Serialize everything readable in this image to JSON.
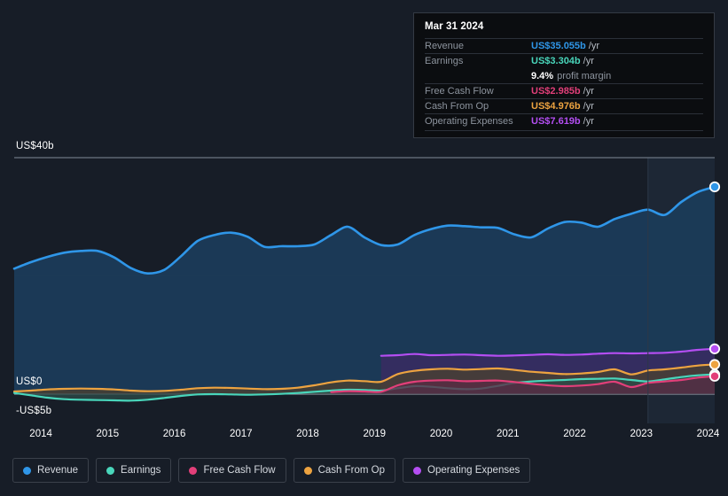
{
  "tooltip": {
    "date": "Mar 31 2024",
    "rows": [
      {
        "name": "Revenue",
        "value": "US$35.055b",
        "unit": "/yr",
        "color": "#2f96e8"
      },
      {
        "name": "Earnings",
        "value": "US$3.304b",
        "unit": "/yr",
        "color": "#49d6bb"
      },
      {
        "name": "Free Cash Flow",
        "value": "US$2.985b",
        "unit": "/yr",
        "color": "#e23f79"
      },
      {
        "name": "Cash From Op",
        "value": "US$4.976b",
        "unit": "/yr",
        "color": "#eda340"
      },
      {
        "name": "Operating Expenses",
        "value": "US$7.619b",
        "unit": "/yr",
        "color": "#b44ef2"
      }
    ],
    "profit_margin_value": "9.4%",
    "profit_margin_label": "profit margin"
  },
  "legend": [
    {
      "label": "Revenue",
      "color": "#2f96e8"
    },
    {
      "label": "Earnings",
      "color": "#49d6bb"
    },
    {
      "label": "Free Cash Flow",
      "color": "#e23f79"
    },
    {
      "label": "Cash From Op",
      "color": "#eda340"
    },
    {
      "label": "Operating Expenses",
      "color": "#b44ef2"
    }
  ],
  "axis": {
    "y_labels": {
      "top": "US$40b",
      "zero": "US$0",
      "bottom": "-US$5b"
    },
    "x_labels": [
      "2014",
      "2015",
      "2016",
      "2017",
      "2018",
      "2019",
      "2020",
      "2021",
      "2022",
      "2023",
      "2024"
    ]
  },
  "chart_data": {
    "type": "area",
    "title": "",
    "xlabel": "",
    "ylabel": "US$",
    "ylim": [
      -5,
      40
    ],
    "grid": true,
    "legend_position": "bottom",
    "gridlines": [
      40,
      20,
      0
    ],
    "x_tick_labels": [
      "2014",
      "2015",
      "2016",
      "2017",
      "2018",
      "2019",
      "2020",
      "2021",
      "2022",
      "2023",
      "2024"
    ],
    "x_tick_positions": [
      2014,
      2015,
      2016,
      2017,
      2018,
      2019,
      2020,
      2021,
      2022,
      2023,
      2024
    ],
    "forecast_start": 2023.1,
    "units": "US$ billions per year",
    "x": [
      2013.6,
      2013.85,
      2014.1,
      2014.35,
      2014.6,
      2014.85,
      2015.1,
      2015.35,
      2015.6,
      2015.85,
      2016.1,
      2016.35,
      2016.6,
      2016.85,
      2017.1,
      2017.35,
      2017.6,
      2017.85,
      2018.1,
      2018.35,
      2018.6,
      2018.85,
      2019.1,
      2019.35,
      2019.6,
      2019.85,
      2020.1,
      2020.35,
      2020.6,
      2020.85,
      2021.1,
      2021.35,
      2021.6,
      2021.85,
      2022.1,
      2022.35,
      2022.6,
      2022.85,
      2023.1,
      2023.35,
      2023.6,
      2023.85,
      2024.1
    ],
    "series": [
      {
        "name": "Revenue",
        "color": "#2f96e8",
        "fill": "#1b3b58",
        "end_value": 35.055,
        "end_marker": true,
        "values": [
          21.2,
          22.3,
          23.2,
          23.9,
          24.2,
          24.2,
          23.1,
          21.3,
          20.4,
          21.0,
          23.3,
          25.9,
          26.9,
          27.3,
          26.6,
          24.9,
          25.0,
          25.0,
          25.3,
          26.9,
          28.3,
          26.5,
          25.2,
          25.3,
          26.9,
          27.9,
          28.5,
          28.4,
          28.2,
          28.1,
          27.0,
          26.5,
          28.0,
          29.1,
          29.0,
          28.3,
          29.6,
          30.5,
          31.2,
          30.3,
          32.5,
          34.2,
          35.055
        ]
      },
      {
        "name": "Operating Expenses",
        "color": "#b44ef2",
        "fill": "#3b2a63",
        "start_x": 2019.05,
        "end_value": 7.619,
        "end_marker": true,
        "values": [
          null,
          null,
          null,
          null,
          null,
          null,
          null,
          null,
          null,
          null,
          null,
          null,
          null,
          null,
          null,
          null,
          null,
          null,
          null,
          null,
          null,
          null,
          6.45,
          6.55,
          6.75,
          6.55,
          6.6,
          6.65,
          6.55,
          6.45,
          6.5,
          6.6,
          6.7,
          6.6,
          6.65,
          6.8,
          6.9,
          6.85,
          6.9,
          6.95,
          7.15,
          7.45,
          7.619
        ]
      },
      {
        "name": "Cash From Op",
        "color": "#eda340",
        "fill": "#4a4030",
        "end_value": 4.976,
        "end_marker": true,
        "values": [
          0.4,
          0.55,
          0.75,
          0.85,
          0.9,
          0.85,
          0.75,
          0.55,
          0.45,
          0.5,
          0.7,
          0.95,
          1.05,
          1.0,
          0.9,
          0.8,
          0.85,
          1.05,
          1.45,
          1.95,
          2.25,
          2.15,
          2.05,
          3.35,
          3.9,
          4.15,
          4.25,
          4.1,
          4.2,
          4.3,
          4.05,
          3.75,
          3.55,
          3.35,
          3.45,
          3.7,
          4.15,
          3.3,
          3.95,
          4.15,
          4.45,
          4.8,
          4.976
        ]
      },
      {
        "name": "Earnings",
        "color": "#49d6bb",
        "fill": "#2c4a48",
        "end_value": 3.304,
        "end_marker": true,
        "values": [
          0.15,
          -0.25,
          -0.65,
          -0.9,
          -1.0,
          -1.05,
          -1.1,
          -1.15,
          -1.0,
          -0.7,
          -0.35,
          -0.1,
          -0.05,
          -0.1,
          -0.15,
          -0.1,
          0.0,
          0.15,
          0.35,
          0.55,
          0.7,
          0.65,
          0.55,
          0.95,
          1.3,
          1.2,
          0.95,
          0.8,
          0.9,
          1.35,
          1.85,
          2.1,
          2.25,
          2.35,
          2.5,
          2.55,
          2.6,
          2.35,
          2.1,
          2.45,
          2.85,
          3.15,
          3.304
        ]
      },
      {
        "name": "Free Cash Flow",
        "color": "#e23f79",
        "fill": "#5a2a44",
        "start_x": 2018.3,
        "end_value": 2.985,
        "end_marker": true,
        "values": [
          null,
          null,
          null,
          null,
          null,
          null,
          null,
          null,
          null,
          null,
          null,
          null,
          null,
          null,
          null,
          null,
          null,
          null,
          null,
          0.3,
          0.45,
          0.4,
          0.35,
          1.45,
          2.05,
          2.25,
          2.3,
          2.15,
          2.2,
          2.25,
          2.0,
          1.7,
          1.45,
          1.3,
          1.4,
          1.65,
          2.05,
          1.15,
          1.85,
          2.1,
          2.35,
          2.75,
          2.985
        ]
      }
    ]
  }
}
